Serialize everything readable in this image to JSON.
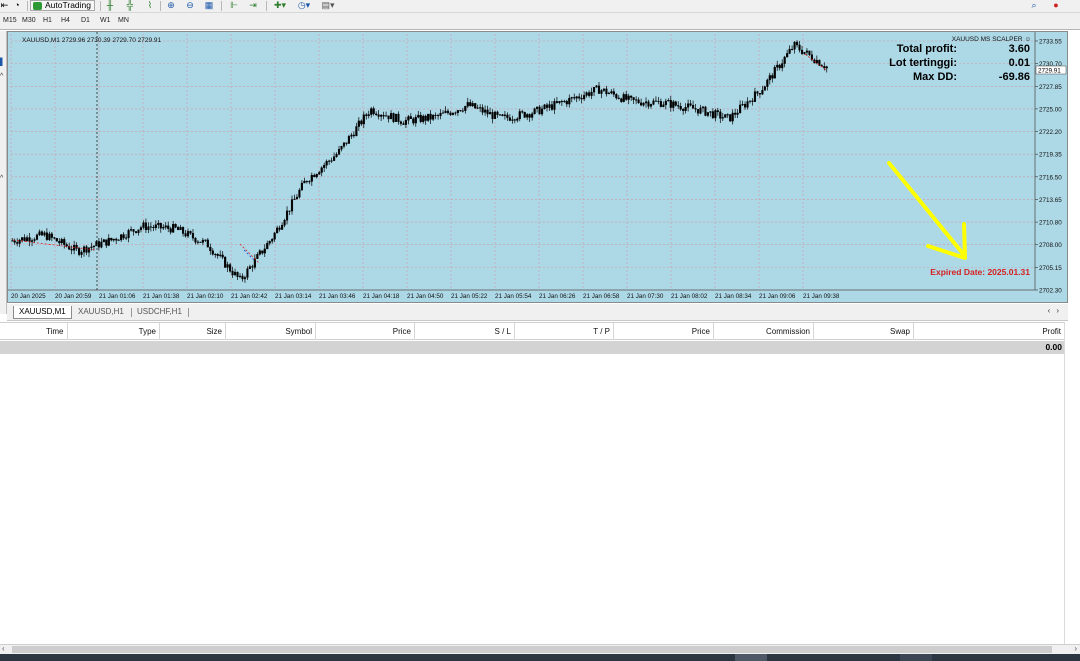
{
  "toolbar": {
    "autotrading_label": "AutoTrading"
  },
  "timeframes": [
    "M15",
    "M30",
    "H1",
    "H4",
    "D1",
    "W1",
    "MN"
  ],
  "chart": {
    "info_text": "XAUUSD,M1  2729.96 2730.39 2729.70 2729.91",
    "ea_name": "XAUUSD MS SCALPER ☺",
    "background_color": "#add8e6",
    "candle_color": "#000000",
    "current_price_label": "2729.91",
    "price_ticks": [
      "2733.55",
      "2730.70",
      "2727.85",
      "2725.00",
      "2722.20",
      "2719.35",
      "2716.50",
      "2713.65",
      "2710.80",
      "2708.00",
      "2705.15",
      "2702.30"
    ],
    "time_ticks": [
      "20 Jan 2025",
      "20 Jan 20:59",
      "21 Jan 01:06",
      "21 Jan 01:38",
      "21 Jan 02:10",
      "21 Jan 02:42",
      "21 Jan 03:14",
      "21 Jan 03:46",
      "21 Jan 04:18",
      "21 Jan 04:50",
      "21 Jan 05:22",
      "21 Jan 05:54",
      "21 Jan 06:26",
      "21 Jan 06:58",
      "21 Jan 07:30",
      "21 Jan 08:02",
      "21 Jan 08:34",
      "21 Jan 09:06",
      "21 Jan 09:38"
    ],
    "ea_panel": [
      {
        "label": "Total profit:",
        "value": "3.60"
      },
      {
        "label": "Lot tertinggi:",
        "value": "0.01"
      },
      {
        "label": "Max DD:",
        "value": "-69.86"
      }
    ],
    "expired_text": "Expired Date: 2025.01.31",
    "expired_color": "#d62020",
    "arrow_color": "#ffff00"
  },
  "chart_tabs": [
    "XAUUSD,M1",
    "XAUUSD,H1",
    "USDCHF,H1"
  ],
  "table": {
    "columns": [
      "Time",
      "Type",
      "Size",
      "Symbol",
      "Price",
      "S / L",
      "T / P",
      "Price",
      "Commission",
      "Swap",
      "Profit"
    ],
    "balance_profit": "0.00"
  },
  "chart_data": {
    "type": "line",
    "title": "",
    "xlabel": "",
    "ylabel": "",
    "ylim": [
      2702.3,
      2733.55
    ],
    "x": [
      "20 Jan 2025",
      "20 Jan 20:59",
      "21 Jan 01:06",
      "21 Jan 01:38",
      "21 Jan 02:10",
      "21 Jan 02:42",
      "21 Jan 03:14",
      "21 Jan 03:46",
      "21 Jan 04:18",
      "21 Jan 04:50",
      "21 Jan 05:22",
      "21 Jan 05:54",
      "21 Jan 06:26",
      "21 Jan 06:58",
      "21 Jan 07:30",
      "21 Jan 08:02",
      "21 Jan 08:34",
      "21 Jan 09:06",
      "21 Jan 09:38"
    ],
    "series": [
      {
        "values": [
          2708.5,
          2709.2,
          2707.2,
          2708.5,
          2710.3,
          2710.0,
          2708.0,
          2703.5,
          2709.0,
          2716.0,
          2719.5,
          2725.0,
          2723.5,
          2724.0,
          2725.5,
          2723.8,
          2724.6,
          2726.0,
          2727.5,
          2726.0,
          2725.8,
          2725.0,
          2723.8,
          2727.5,
          2733.0,
          2730.3
        ]
      }
    ],
    "grid": true,
    "grid_color": "#cf9aa8"
  }
}
